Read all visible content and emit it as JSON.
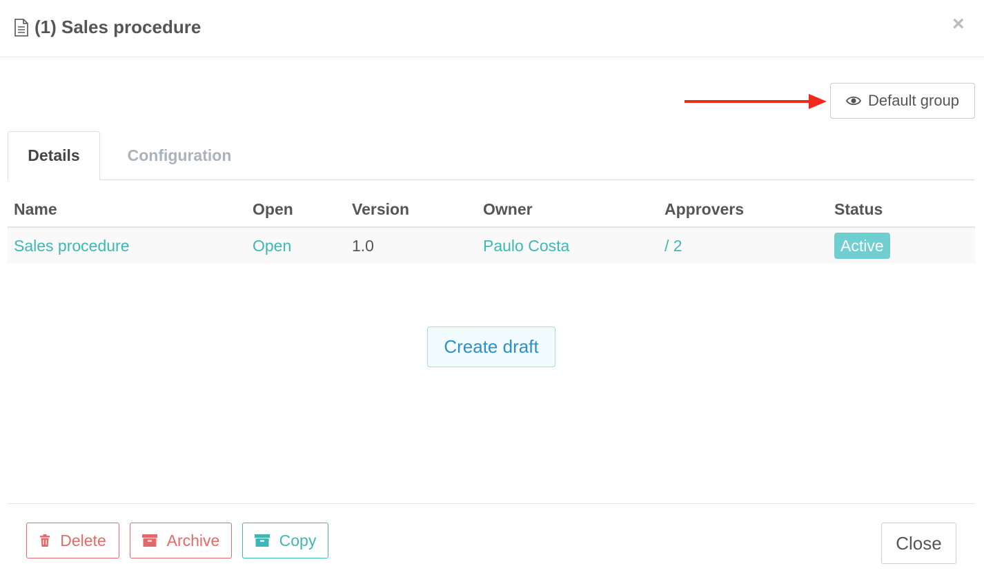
{
  "header": {
    "title": "(1) Sales procedure",
    "close_symbol": "×"
  },
  "group_button": {
    "label": "Default group",
    "icon": "eye-icon"
  },
  "annotation": {
    "arrow_color": "#f0291a"
  },
  "tabs": [
    {
      "label": "Details",
      "active": true
    },
    {
      "label": "Configuration",
      "active": false
    }
  ],
  "table": {
    "columns": [
      "Name",
      "Open",
      "Version",
      "Owner",
      "Approvers",
      "Status"
    ],
    "rows": [
      {
        "name": "Sales procedure",
        "open": "Open",
        "version": "1.0",
        "owner": "Paulo Costa",
        "approvers": "/ 2",
        "status": "Active"
      }
    ]
  },
  "create_draft_label": "Create draft",
  "footer": {
    "delete_label": "Delete",
    "archive_label": "Archive",
    "copy_label": "Copy",
    "close_label": "Close"
  },
  "colors": {
    "link": "#3fb7b4",
    "danger": "#e26a6a",
    "status_active": "#6fcfd0",
    "primary_text": "#2d8fc8"
  }
}
